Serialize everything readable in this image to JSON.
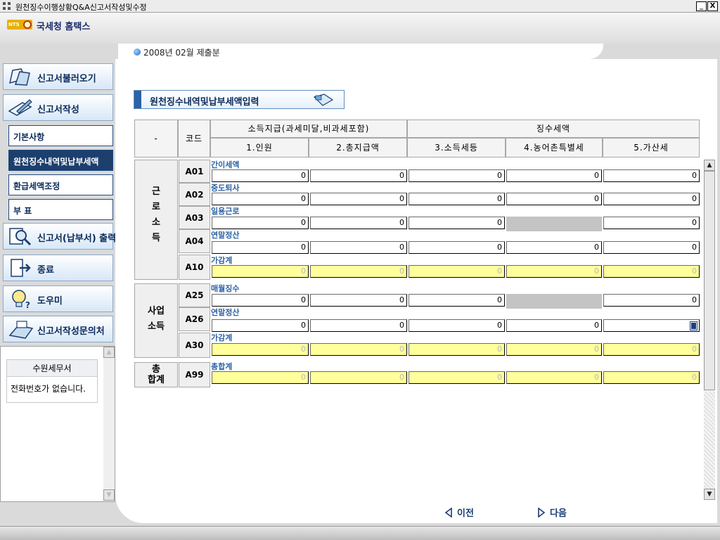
{
  "window": {
    "title": "원천징수이행상황Q&A신고서작성및수정",
    "minimize_label": "_",
    "close_label": "X"
  },
  "header": {
    "logo_text": "NTS",
    "brand": "국세청 홈택스"
  },
  "period": {
    "text": "2008년  02월  제출분"
  },
  "sidebar": {
    "load": "신고서불러오기",
    "write": "신고서작성",
    "sub_items": [
      "기본사항",
      "원천징수내역및납부세액",
      "환급세액조정",
      "부 표"
    ],
    "print": "신고서(납부서) 출력",
    "exit": "종료",
    "help": "도우미",
    "contact": "신고서작성문의처"
  },
  "office": {
    "name": "수원세무서",
    "phone": "전화번호가 없습니다."
  },
  "section": {
    "title": "원천징수내역및납부세액입력"
  },
  "table": {
    "dash": "-",
    "code_header": "코드",
    "income_header": "소득지급(과세미달,비과세포함)",
    "tax_header": "징수세액",
    "col1": "1.인원",
    "col2": "2.총지급액",
    "col3": "3.소득세등",
    "col4": "4.농어촌특별세",
    "col5": "5.가산세",
    "group_labor": "근로소득",
    "group_labor_chars": [
      "근",
      "로",
      "소",
      "득"
    ],
    "group_business_1": "사업",
    "group_business_2": "소득",
    "group_total_1": "총",
    "group_total_2": "합계",
    "rows": [
      {
        "code": "A01",
        "label": "간이세액",
        "values": [
          "0",
          "0",
          "0",
          "0",
          "0"
        ]
      },
      {
        "code": "A02",
        "label": "중도퇴사",
        "values": [
          "0",
          "0",
          "0",
          "0",
          "0"
        ]
      },
      {
        "code": "A03",
        "label": "일용근로",
        "values": [
          "0",
          "0",
          "0",
          "",
          "0"
        ]
      },
      {
        "code": "A04",
        "label": "연말정산",
        "values": [
          "0",
          "0",
          "0",
          "0",
          "0"
        ]
      },
      {
        "code": "A10",
        "label": "가감계",
        "values": [
          "0",
          "0",
          "0",
          "0",
          "0"
        ]
      },
      {
        "code": "A25",
        "label": "매월징수",
        "values": [
          "0",
          "0",
          "0",
          "",
          "0"
        ]
      },
      {
        "code": "A26",
        "label": "연말정산",
        "values": [
          "0",
          "0",
          "0",
          "0",
          ""
        ]
      },
      {
        "code": "A30",
        "label": "가감계",
        "values": [
          "0",
          "0",
          "0",
          "0",
          "0"
        ]
      },
      {
        "code": "A99",
        "label": "총합계",
        "values": [
          "0",
          "0",
          "0",
          "0",
          "0"
        ]
      }
    ]
  },
  "pager": {
    "prev": "이전",
    "next": "다음"
  },
  "colors": {
    "sum_field": "#ffff9c",
    "disabled_field": "#c4c4c4",
    "label_blue": "#2b62a6",
    "nav_dark": "#1d3f6e"
  },
  "icons": [
    "window-app-icon",
    "nts-logo",
    "period-dot-icon",
    "folder-open-icon",
    "pen-write-icon",
    "magnifier-print-icon",
    "exit-door-icon",
    "lightbulb-help-icon",
    "fax-phone-icon",
    "notebook-icon",
    "prev-arrow-icon",
    "next-arrow-icon"
  ]
}
